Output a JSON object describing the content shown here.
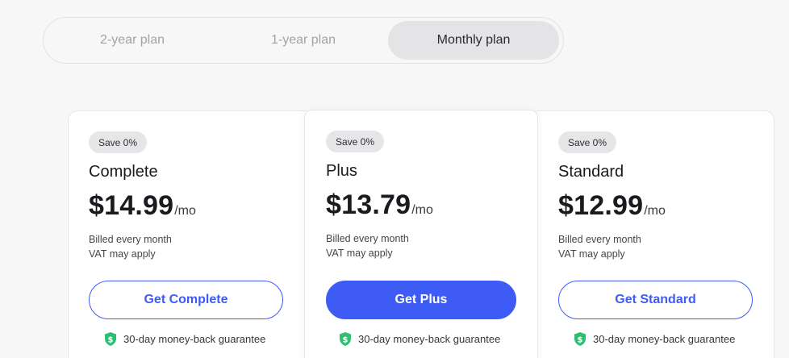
{
  "switcher": {
    "options": [
      "2-year plan",
      "1-year plan",
      "Monthly plan"
    ],
    "selected": "Monthly plan"
  },
  "plans": [
    {
      "badge": "Save 0%",
      "name": "Complete",
      "price": "$14.99",
      "per": "/mo",
      "billing": "Billed every month",
      "vat": "VAT may apply",
      "cta": "Get Complete",
      "guarantee": "30-day money-back guarantee"
    },
    {
      "badge": "Save 0%",
      "name": "Plus",
      "price": "$13.79",
      "per": "/mo",
      "billing": "Billed every month",
      "vat": "VAT may apply",
      "cta": "Get Plus",
      "guarantee": "30-day money-back guarantee"
    },
    {
      "badge": "Save 0%",
      "name": "Standard",
      "price": "$12.99",
      "per": "/mo",
      "billing": "Billed every month",
      "vat": "VAT may apply",
      "cta": "Get Standard",
      "guarantee": "30-day money-back guarantee"
    }
  ],
  "colors": {
    "accent": "#3e5bf5",
    "shield": "#2fbf71",
    "background": "#f7f7f7"
  },
  "icons": {
    "guarantee": "shield-check-icon"
  }
}
